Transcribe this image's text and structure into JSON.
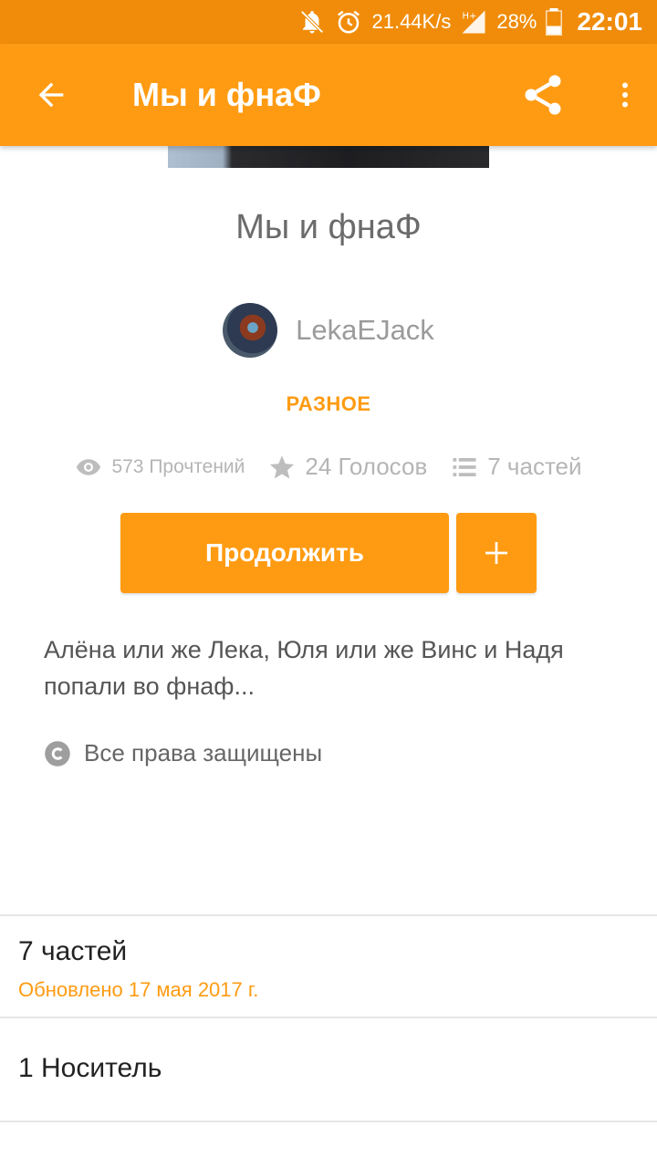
{
  "status_bar": {
    "network_speed": "21.44K/s",
    "battery": "28%",
    "time": "22:01",
    "icons": [
      "bell-off-icon",
      "alarm-icon",
      "signal-icon",
      "battery-icon"
    ]
  },
  "app_bar": {
    "title": "Мы и фнаФ",
    "back_icon": "arrow-left-icon",
    "share_icon": "share-icon",
    "menu_icon": "more-vert-icon"
  },
  "story": {
    "title": "Мы и фнаФ",
    "author": "LekaEJack",
    "category": "РАЗНОЕ",
    "reads": "573 Прочтений",
    "votes": "24 Голосов",
    "parts": "7 частей",
    "continue_label": "Продолжить",
    "add_label": "+",
    "description": "Алёна или же Лека, Юля или же Винс и Надя попали во фнаф...",
    "copyright": "Все права защищены"
  },
  "table_of_contents": {
    "parts_title": "7 частей",
    "updated": "Обновлено 17 мая 2017 г."
  },
  "carrier": {
    "label": "1 Носитель"
  },
  "colors": {
    "accent": "#ff9b12",
    "status_bar": "#f08c0a",
    "muted_text": "#b5b5b5"
  }
}
